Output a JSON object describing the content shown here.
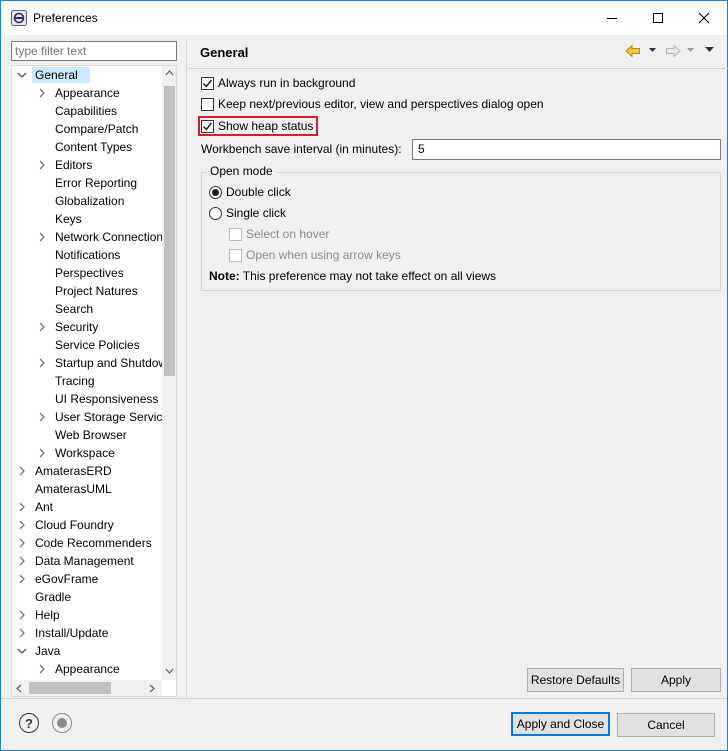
{
  "window": {
    "title": "Preferences",
    "buttons": {
      "minimize": "minimize-icon",
      "maximize": "maximize-icon",
      "close": "close-icon"
    }
  },
  "filter": {
    "placeholder": "type filter text",
    "value": ""
  },
  "tree": {
    "items": [
      {
        "label": "General",
        "level": 0,
        "arrow": "down",
        "selected": true
      },
      {
        "label": "Appearance",
        "level": 1,
        "arrow": "right"
      },
      {
        "label": "Capabilities",
        "level": 1,
        "arrow": "none"
      },
      {
        "label": "Compare/Patch",
        "level": 1,
        "arrow": "none"
      },
      {
        "label": "Content Types",
        "level": 1,
        "arrow": "none"
      },
      {
        "label": "Editors",
        "level": 1,
        "arrow": "right"
      },
      {
        "label": "Error Reporting",
        "level": 1,
        "arrow": "none"
      },
      {
        "label": "Globalization",
        "level": 1,
        "arrow": "none"
      },
      {
        "label": "Keys",
        "level": 1,
        "arrow": "none"
      },
      {
        "label": "Network Connection",
        "level": 1,
        "arrow": "right"
      },
      {
        "label": "Notifications",
        "level": 1,
        "arrow": "none"
      },
      {
        "label": "Perspectives",
        "level": 1,
        "arrow": "none"
      },
      {
        "label": "Project Natures",
        "level": 1,
        "arrow": "none"
      },
      {
        "label": "Search",
        "level": 1,
        "arrow": "none"
      },
      {
        "label": "Security",
        "level": 1,
        "arrow": "right"
      },
      {
        "label": "Service Policies",
        "level": 1,
        "arrow": "none"
      },
      {
        "label": "Startup and Shutdown",
        "level": 1,
        "arrow": "right"
      },
      {
        "label": "Tracing",
        "level": 1,
        "arrow": "none"
      },
      {
        "label": "UI Responsiveness M",
        "level": 1,
        "arrow": "none"
      },
      {
        "label": "User Storage Service",
        "level": 1,
        "arrow": "right"
      },
      {
        "label": "Web Browser",
        "level": 1,
        "arrow": "none"
      },
      {
        "label": "Workspace",
        "level": 1,
        "arrow": "right"
      },
      {
        "label": "AmaterasERD",
        "level": 0,
        "arrow": "right"
      },
      {
        "label": "AmaterasUML",
        "level": 0,
        "arrow": "none"
      },
      {
        "label": "Ant",
        "level": 0,
        "arrow": "right"
      },
      {
        "label": "Cloud Foundry",
        "level": 0,
        "arrow": "right"
      },
      {
        "label": "Code Recommenders",
        "level": 0,
        "arrow": "right"
      },
      {
        "label": "Data Management",
        "level": 0,
        "arrow": "right"
      },
      {
        "label": "eGovFrame",
        "level": 0,
        "arrow": "right"
      },
      {
        "label": "Gradle",
        "level": 0,
        "arrow": "none"
      },
      {
        "label": "Help",
        "level": 0,
        "arrow": "right"
      },
      {
        "label": "Install/Update",
        "level": 0,
        "arrow": "right"
      },
      {
        "label": "Java",
        "level": 0,
        "arrow": "down"
      },
      {
        "label": "Appearance",
        "level": 1,
        "arrow": "right"
      }
    ]
  },
  "page": {
    "title": "General",
    "nav_icons": [
      "back-icon",
      "back-menu-icon",
      "forward-icon",
      "forward-menu-icon",
      "view-menu-icon"
    ],
    "options": {
      "always_run_background": {
        "label": "Always run in background",
        "checked": true
      },
      "keep_next_prev": {
        "label": "Keep next/previous editor, view and perspectives dialog open",
        "checked": false
      },
      "show_heap_status": {
        "label": "Show heap status",
        "checked": true
      }
    },
    "save_interval": {
      "label": "Workbench save interval (in minutes):",
      "value": "5"
    },
    "open_mode": {
      "legend": "Open mode",
      "double_click": {
        "label": "Double click",
        "selected": true
      },
      "single_click": {
        "label": "Single click",
        "selected": false
      },
      "select_on_hover": {
        "label": "Select on hover",
        "enabled": false
      },
      "open_arrow_keys": {
        "label": "Open when using arrow keys",
        "enabled": false
      },
      "note_bold": "Note:",
      "note_text": "This preference may not take effect on all views"
    },
    "restore_defaults": "Restore Defaults",
    "apply": "Apply"
  },
  "footer": {
    "help_icon": "help-icon",
    "import_export_icon": "import-export-icon",
    "apply_close": "Apply and Close",
    "cancel": "Cancel"
  },
  "colors": {
    "accent": "#0078d7",
    "highlight": "#d81e2c",
    "selection": "#cce8ff"
  }
}
